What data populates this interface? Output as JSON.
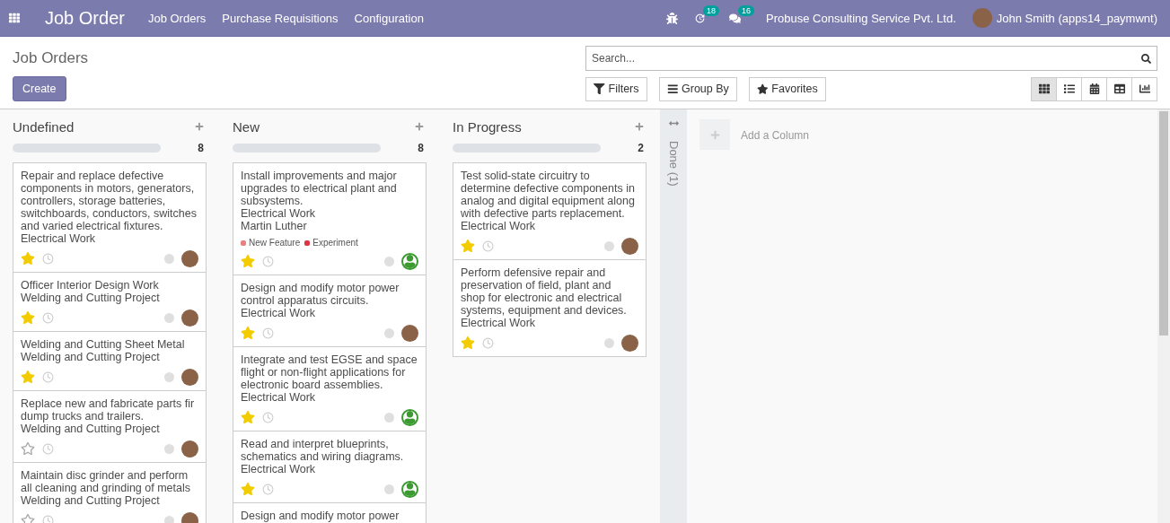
{
  "navbar": {
    "app_title": "Job Order",
    "menu": [
      "Job Orders",
      "Purchase Requisitions",
      "Configuration"
    ],
    "activity_count": "18",
    "message_count": "16",
    "company": "Probuse Consulting Service Pvt. Ltd.",
    "user": "John Smith (apps14_paymwnt)"
  },
  "control_panel": {
    "breadcrumb": "Job Orders",
    "create_button": "Create",
    "search": {
      "placeholder": "Search..."
    },
    "filters": [
      "Filters",
      "Group By",
      "Favorites"
    ],
    "views": [
      {
        "kind": "kanban",
        "selected": true
      },
      {
        "kind": "list",
        "selected": false
      },
      {
        "kind": "calendar",
        "selected": false
      },
      {
        "kind": "pivot",
        "selected": false
      },
      {
        "kind": "graph",
        "selected": false
      }
    ]
  },
  "columns": [
    {
      "title": "Undefined",
      "count": "8",
      "level": 0,
      "cards": [
        {
          "title": "Repair and replace defective components in motors, generators, controllers, storage batteries, switchboards, conductors, switches and varied electrical fixtures.",
          "project": "Electrical Work",
          "starred": true,
          "kind": "photo"
        },
        {
          "title": "Officer Interior Design Work",
          "project": "Welding and Cutting Project",
          "starred": true,
          "kind": "photo"
        },
        {
          "title": "Welding and Cutting Sheet Metal",
          "project": "Welding and Cutting Project",
          "starred": true,
          "kind": "photo"
        },
        {
          "title": "Replace new and fabricate parts fir dump trucks and trailers.",
          "project": "Welding and Cutting Project",
          "starred": false,
          "kind": "photo"
        },
        {
          "title": "Maintain disc grinder and perform all cleaning and grinding of metals",
          "project": "Welding and Cutting Project",
          "starred": false,
          "kind": "photo"
        }
      ]
    },
    {
      "title": "New",
      "count": "8",
      "level": 0,
      "cards": [
        {
          "title": "Install improvements and major upgrades to electrical plant and subsystems.",
          "project": "Electrical Work",
          "assignee": "Martin Luther",
          "tags": [
            {
              "label": "New Feature",
              "color": "#e88080"
            },
            {
              "label": "Experiment",
              "color": "#dc3545"
            }
          ],
          "starred": true,
          "kind": "generic"
        },
        {
          "title": "Design and modify motor power control apparatus circuits.",
          "project": "Electrical Work",
          "starred": true,
          "kind": "photo"
        },
        {
          "title": "Integrate and test EGSE and space flight or non-flight applications for electronic board assemblies.",
          "project": "Electrical Work",
          "starred": true,
          "kind": "generic"
        },
        {
          "title": "Read and interpret blueprints, schematics and wiring diagrams.",
          "project": "Electrical Work",
          "starred": true,
          "kind": "generic"
        },
        {
          "title": "Design and modify motor power"
        }
      ]
    },
    {
      "title": "In Progress",
      "count": "2",
      "level": 0,
      "cards": [
        {
          "title": "Test solid-state circuitry to determine defective components in analog and digital equipment along with defective parts replacement.",
          "project": "Electrical Work",
          "starred": true,
          "kind": "photo"
        },
        {
          "title": "Perform defensive repair and preservation of field, plant and shop for electronic and electrical systems, equipment and devices.",
          "project": "Electrical Work",
          "starred": true,
          "kind": "photo"
        }
      ]
    }
  ],
  "folded_column": {
    "title": "Done (1)"
  },
  "add_column": {
    "label": "Add a Column"
  }
}
